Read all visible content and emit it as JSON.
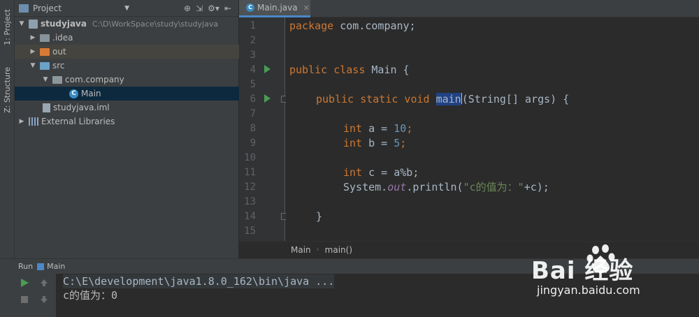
{
  "stripe": {
    "project_tab": "1: Project",
    "structure_tab": "Z: Structure"
  },
  "project_panel": {
    "title": "Project",
    "tree": [
      {
        "label": "studyjava",
        "hint": "C:\\D\\WorkSpace\\study\\studyjava"
      },
      {
        "label": ".idea"
      },
      {
        "label": "out"
      },
      {
        "label": "src"
      },
      {
        "label": "com.company"
      },
      {
        "label": "Main"
      },
      {
        "label": "studyjava.iml"
      },
      {
        "label": "External Libraries"
      }
    ]
  },
  "editor": {
    "tab_label": "Main.java",
    "line_numbers": [
      "1",
      "2",
      "3",
      "4",
      "5",
      "6",
      "7",
      "8",
      "9",
      "10",
      "11",
      "12",
      "13",
      "14",
      "15"
    ],
    "code": {
      "l1_kw": "package",
      "l1_rest": " com.company;",
      "l4_kw": "public class",
      "l4_rest": " Main {",
      "l6_kw": "public static void",
      "l6_sel": "main",
      "l6_rest": "(String[] args) {",
      "l8_kw": "int",
      "l8_a": " a = ",
      "l8_num": "10",
      "l8_end": ";",
      "l9_kw": "int",
      "l9_a": " b = ",
      "l9_num": "5",
      "l9_end": ";",
      "l11_kw": "int",
      "l11_rest": " c = a%b;",
      "l12_a": "System.",
      "l12_fld": "out",
      "l12_b": ".println(",
      "l12_str": "\"c的值为：\"",
      "l12_c": "+c);",
      "l14_rest": "}"
    },
    "breadcrumb": [
      "Main",
      "main()"
    ]
  },
  "run_panel": {
    "label": "Run",
    "config": "Main",
    "console": [
      "C:\\E\\development\\java1.8.0_162\\bin\\java ...",
      "c的值为：0"
    ]
  },
  "watermark": {
    "brand": "Bai  经验",
    "url": "jingyan.baidu.com"
  },
  "colors": {
    "keyword": "#cc7832",
    "number": "#6897bb",
    "string": "#6a8759",
    "field": "#9876aa",
    "selection": "#214283",
    "run_green": "#499c54"
  }
}
